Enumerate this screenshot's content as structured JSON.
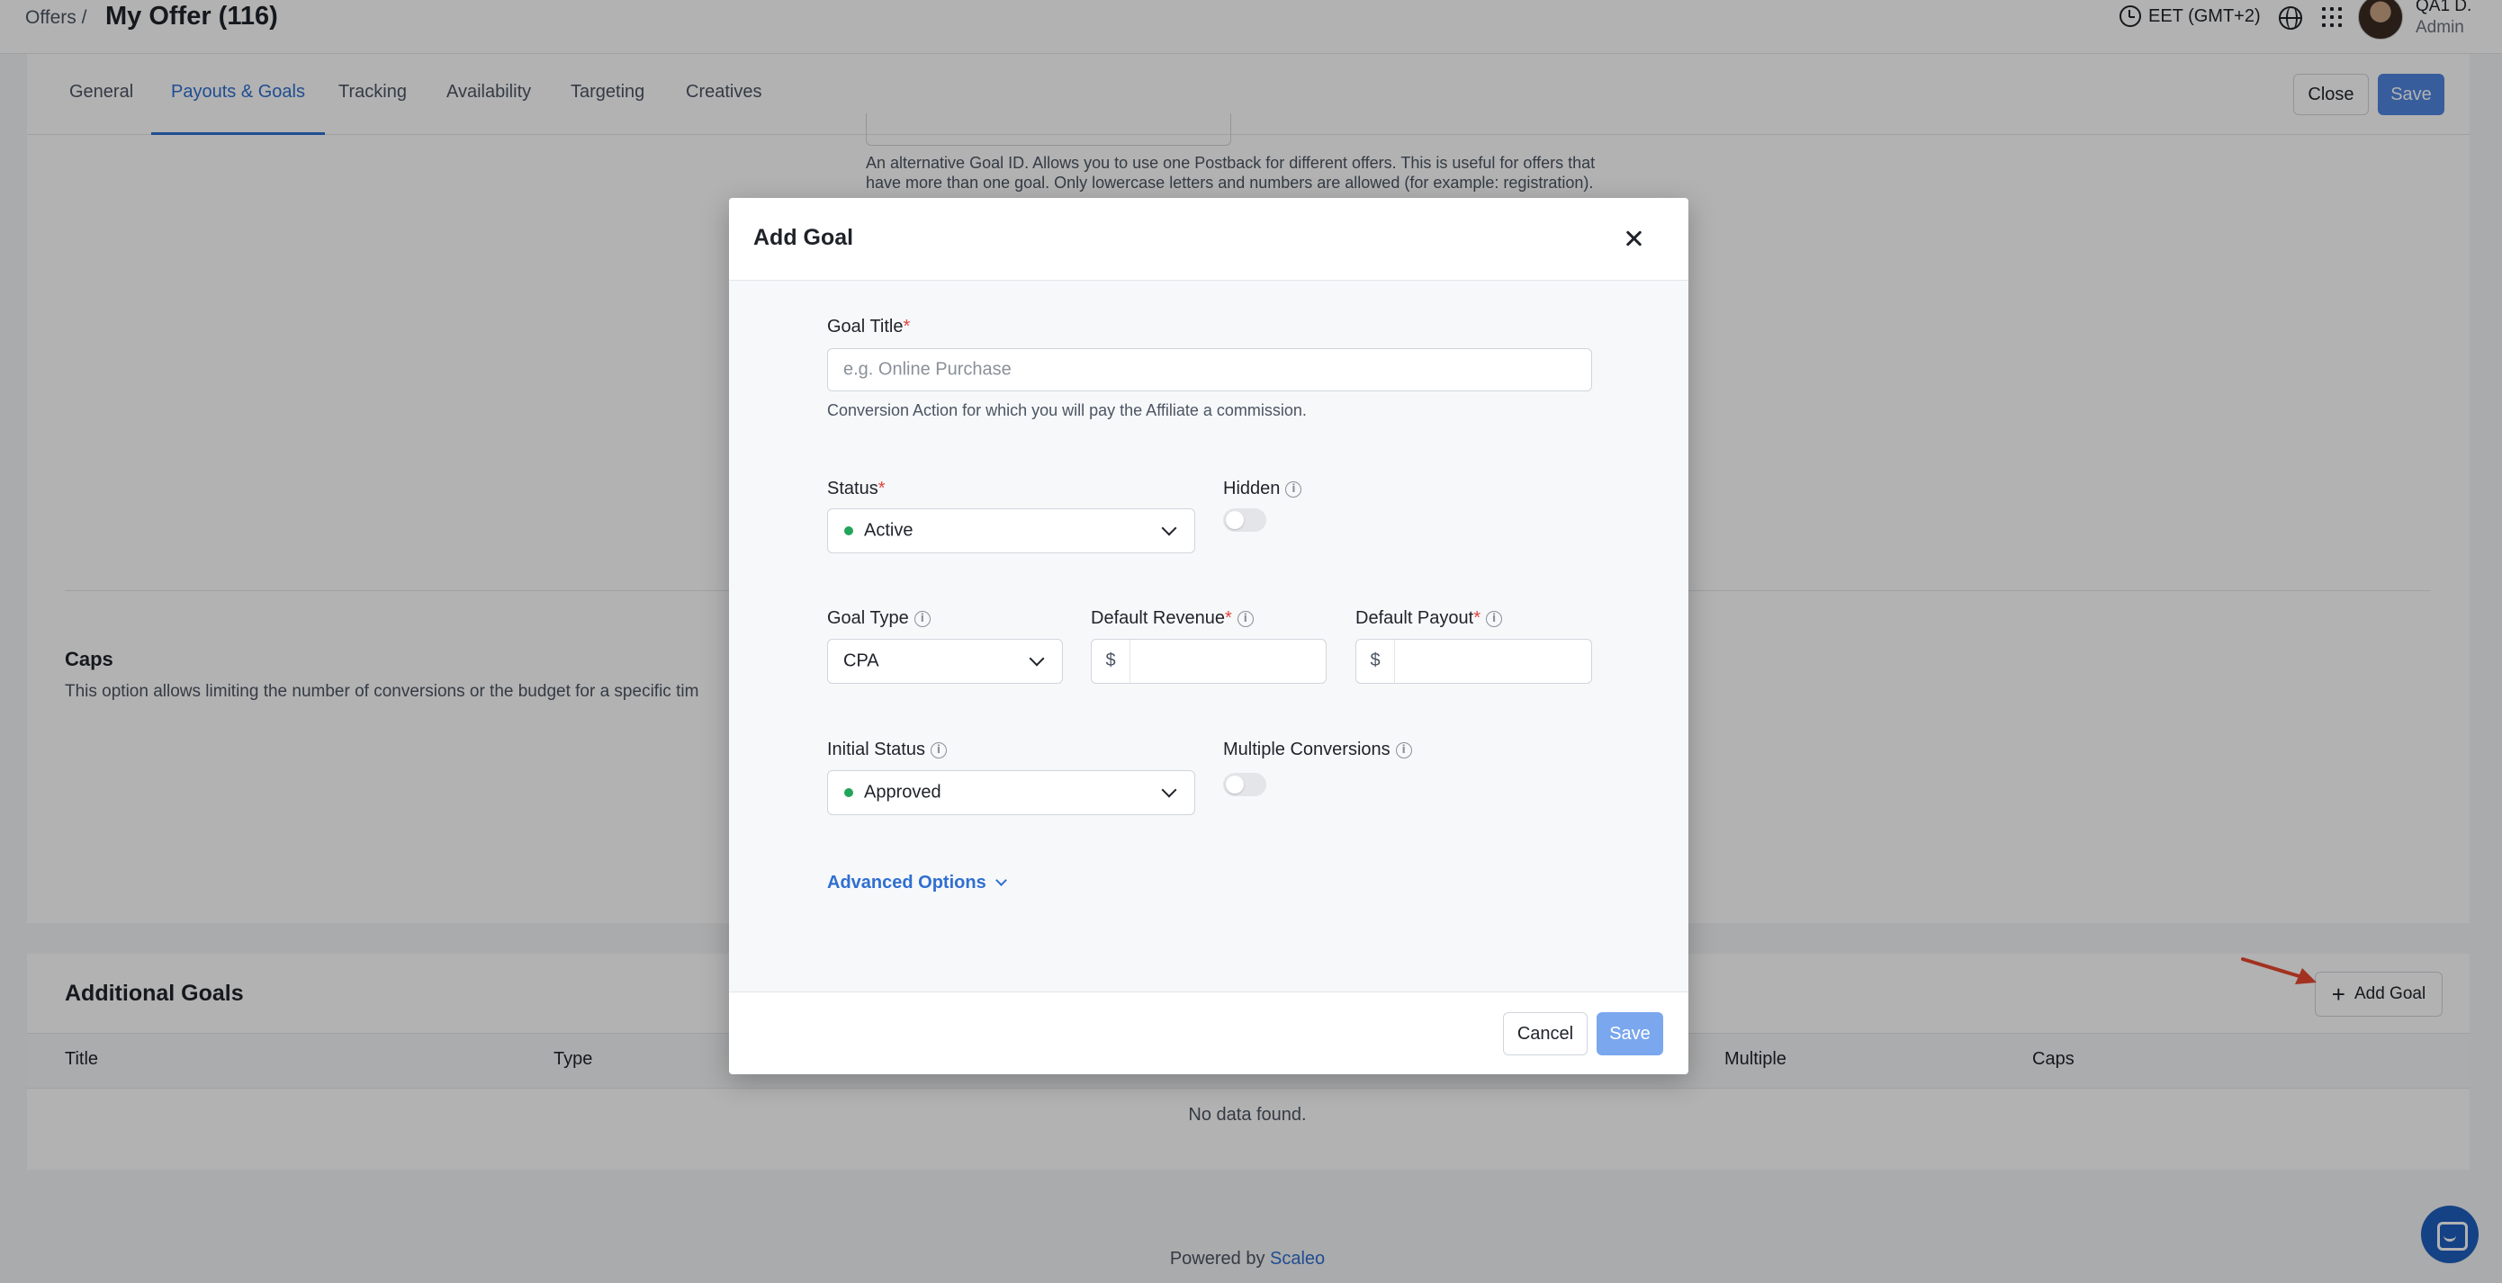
{
  "header": {
    "breadcrumb": "Offers /",
    "title": "My Offer (116)",
    "timezone": "EET (GMT+2)",
    "user_name": "QA1 D.",
    "user_role": "Admin"
  },
  "tabs": [
    {
      "label": "General"
    },
    {
      "label": "Payouts & Goals",
      "active": true
    },
    {
      "label": "Tracking"
    },
    {
      "label": "Availability"
    },
    {
      "label": "Targeting"
    },
    {
      "label": "Creatives"
    }
  ],
  "actions": {
    "close_label": "Close",
    "save_label": "Save"
  },
  "background": {
    "alt_goal_help": "An alternative Goal ID. Allows you to use one Postback for different offers. This is useful for offers that have more than one goal. Only lowercase letters and numbers are allowed (for example: registration).",
    "caps_title": "Caps",
    "caps_desc": "This option allows limiting the number of conversions or the budget for a specific tim"
  },
  "additional_goals": {
    "title": "Additional Goals",
    "add_button": "Add Goal",
    "columns": [
      "Title",
      "Type",
      "Multiple",
      "Caps"
    ],
    "empty_text": "No data found."
  },
  "footer": {
    "powered_by": "Powered by",
    "brand": "Scaleo"
  },
  "modal": {
    "title": "Add Goal",
    "goal_title_label": "Goal Title",
    "goal_title_placeholder": "e.g. Online Purchase",
    "goal_title_help": "Conversion Action for which you will pay the Affiliate a commission.",
    "status_label": "Status",
    "status_value": "Active",
    "hidden_label": "Hidden",
    "hidden_on": false,
    "goal_type_label": "Goal Type",
    "goal_type_value": "CPA",
    "default_revenue_label": "Default Revenue",
    "default_payout_label": "Default Payout",
    "currency_symbol": "$",
    "initial_status_label": "Initial Status",
    "initial_status_value": "Approved",
    "multiple_conversions_label": "Multiple Conversions",
    "multiple_conversions_on": false,
    "advanced_options": "Advanced Options",
    "cancel_label": "Cancel",
    "save_label": "Save"
  },
  "colors": {
    "accent": "#2f6fd1",
    "status_green": "#22a55a",
    "required": "#e0443e",
    "annotation_arrow": "#e8472f"
  },
  "icons": [
    "clock-icon",
    "globe-icon",
    "apps-grid-icon",
    "close-icon",
    "info-icon",
    "chevron-down-icon",
    "plus-icon",
    "chat-icon"
  ]
}
